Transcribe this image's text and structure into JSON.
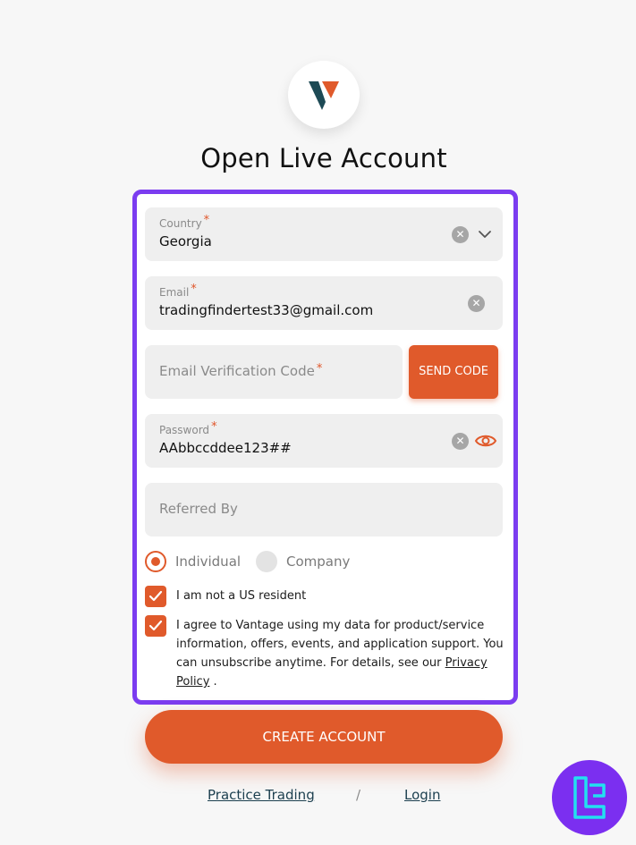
{
  "page": {
    "title": "Open Live Account"
  },
  "form": {
    "country": {
      "label": "Country",
      "required_mark": "*",
      "value": "Georgia"
    },
    "email": {
      "label": "Email",
      "required_mark": "*",
      "value": "tradingfindertest33@gmail.com"
    },
    "verification": {
      "placeholder": "Email Verification Code",
      "required_mark": "*",
      "send_label": "SEND CODE"
    },
    "password": {
      "label": "Password",
      "required_mark": "*",
      "value": "AAbbccddee123##"
    },
    "referred": {
      "placeholder": "Referred By"
    },
    "account_type": {
      "options": [
        "Individual",
        "Company"
      ],
      "selected": "Individual"
    },
    "checks": {
      "not_us_resident": "I am not a US resident",
      "agree_line1": "I agree to Vantage using my data for product/service",
      "agree_line2": "information, offers, events, and application support. You",
      "agree_line3": "can unsubscribe anytime. For details, see our",
      "privacy_part1": "Privacy",
      "privacy_part2": "Policy",
      "agree_end": "."
    },
    "create_label": "CREATE ACCOUNT"
  },
  "footer": {
    "practice_label": "Practice Trading",
    "separator": "/",
    "login_label": "Login"
  },
  "colors": {
    "accent": "#e05a2b",
    "frame": "#7b3cf0",
    "logo_dark": "#1d4a55",
    "badge": "#7b2ff0"
  },
  "icons": {
    "logo": "vantage-logo-icon",
    "clear": "clear-icon",
    "chevron": "chevron-down-icon",
    "eye": "eye-icon",
    "check": "check-icon",
    "badge": "tradingfinder-logo-icon"
  }
}
